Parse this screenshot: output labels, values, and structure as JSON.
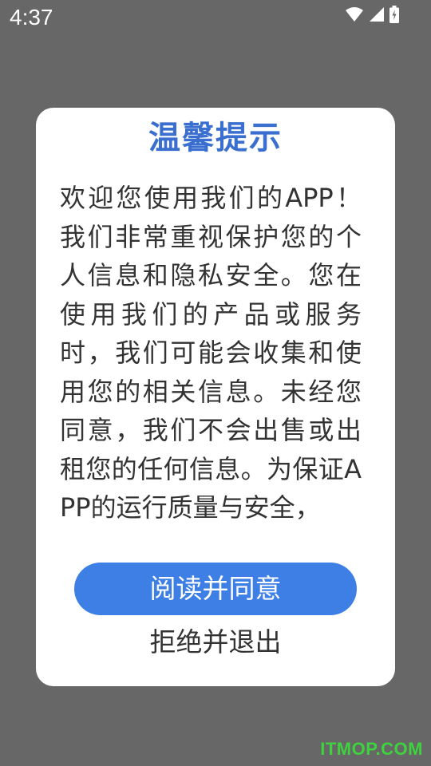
{
  "status_bar": {
    "time": "4:37",
    "icons": [
      "wifi-icon",
      "cellular-signal-icon",
      "battery-charging-icon"
    ]
  },
  "dialog": {
    "title": "温馨提示",
    "body": "欢迎您使用我们的APP！我们非常重视保护您的个人信息和隐私安全。您在使用我们的产品或服务时，我们可能会收集和使用您的相关信息。未经您同意，我们不会出售或出租您的任何信息。为保证APP的运行质量与安全，",
    "agree_label": "阅读并同意",
    "reject_label": "拒绝并退出"
  },
  "watermark": "ITMOP.COM",
  "colors": {
    "overlay": "#676767",
    "title": "#3a6fcf",
    "primary_button": "#3d7fe5",
    "watermark": "#3fd23f"
  }
}
